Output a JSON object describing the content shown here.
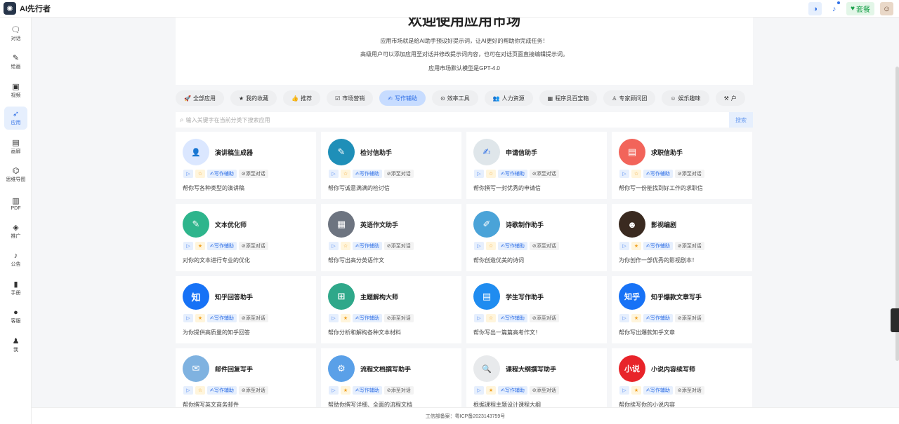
{
  "app": {
    "title": "AI先行者"
  },
  "topbar": {
    "plan_label": "套餐"
  },
  "sidebar": {
    "items": [
      {
        "label": "对话",
        "icon": "chat-icon",
        "glyph": "🗨"
      },
      {
        "label": "绘画",
        "icon": "brush-icon",
        "glyph": "✎"
      },
      {
        "label": "视频",
        "icon": "video-icon",
        "glyph": "▣"
      },
      {
        "label": "应用",
        "icon": "rocket-icon",
        "glyph": "➶",
        "active": true
      },
      {
        "label": "画廊",
        "icon": "gallery-icon",
        "glyph": "▤"
      },
      {
        "label": "思维导图",
        "icon": "mindmap-icon",
        "glyph": "⌬"
      },
      {
        "label": "PDF",
        "icon": "pdf-icon",
        "glyph": "▥"
      },
      {
        "label": "推广",
        "icon": "gem-icon",
        "glyph": "◈"
      },
      {
        "label": "公告",
        "icon": "bell-icon",
        "glyph": "♪"
      },
      {
        "label": "手册",
        "icon": "book-icon",
        "glyph": "▮"
      },
      {
        "label": "客服",
        "icon": "support-icon",
        "glyph": "●"
      },
      {
        "label": "我",
        "icon": "user-icon",
        "glyph": "♟"
      }
    ]
  },
  "hero": {
    "title": "欢迎使用应用市场",
    "line1": "应用市场就是给AI助手预设好提示词，让AI更好的帮助你完成任务！",
    "line2": "高级用户可以添加应用至对话并修改提示词内容，也可在对话页面直接编辑提示词。",
    "line3": "应用市场默认模型是GPT-4.0"
  },
  "tabs": [
    {
      "label": "全部应用",
      "glyph": "🚀"
    },
    {
      "label": "我的收藏",
      "glyph": "★"
    },
    {
      "label": "推荐",
      "glyph": "👍"
    },
    {
      "label": "市场营销",
      "glyph": "☑"
    },
    {
      "label": "写作辅助",
      "glyph": "✍",
      "active": true
    },
    {
      "label": "效率工具",
      "glyph": "⊙"
    },
    {
      "label": "人力资源",
      "glyph": "👥"
    },
    {
      "label": "程序员百宝箱",
      "glyph": "▦"
    },
    {
      "label": "专家顾问团",
      "glyph": "♙"
    },
    {
      "label": "娱乐趣味",
      "glyph": "☺"
    },
    {
      "label": "户",
      "glyph": "⚒"
    }
  ],
  "search": {
    "placeholder": "输入关键字在当前分类下搜索应用",
    "button": "搜索"
  },
  "card_labels": {
    "category": "写作辅助",
    "add": "添至对话"
  },
  "cards": [
    {
      "title": "演讲稿生成器",
      "desc": "帮你写各种类型的演讲稿",
      "fav": false,
      "avatar_color": "#dbe7ff",
      "avatar_text": "👤"
    },
    {
      "title": "检讨信助手",
      "desc": "帮你写诚意满满的检讨信",
      "fav": false,
      "avatar_color": "#1f8fb8",
      "avatar_text": "✎"
    },
    {
      "title": "申请信助手",
      "desc": "帮你撰写一封优秀的申请信",
      "fav": false,
      "avatar_color": "#dfe6ea",
      "avatar_text": "✍"
    },
    {
      "title": "求职信助手",
      "desc": "帮你写一份能找到好工作的求职信",
      "fav": false,
      "avatar_color": "#f2645a",
      "avatar_text": "▤"
    },
    {
      "title": "文本优化师",
      "desc": "对你的文本进行专业的优化",
      "fav": true,
      "avatar_color": "#2eb58c",
      "avatar_text": "✎"
    },
    {
      "title": "英语作文助手",
      "desc": "帮你写出高分英语作文",
      "fav": false,
      "avatar_color": "#6d7480",
      "avatar_text": "▦"
    },
    {
      "title": "诗歌制作助手",
      "desc": "帮你创造优美的诗词",
      "fav": false,
      "avatar_color": "#4aa3d8",
      "avatar_text": "✐"
    },
    {
      "title": "影视编剧",
      "desc": "为你创作一部优秀的影视剧本！",
      "fav": true,
      "avatar_color": "#3a2a20",
      "avatar_text": "☻"
    },
    {
      "title": "知乎回答助手",
      "desc": "为你提供高质量的知乎回答",
      "fav": true,
      "avatar_color": "#1772f6",
      "avatar_text": "知"
    },
    {
      "title": "主题解构大师",
      "desc": "帮你分析和解构各种文本材料",
      "fav": true,
      "avatar_color": "#2fa88a",
      "avatar_text": "⊞"
    },
    {
      "title": "学生写作助手",
      "desc": "帮你写出一篇篇高考作文！",
      "fav": false,
      "avatar_color": "#1f8cf0",
      "avatar_text": "▤"
    },
    {
      "title": "知乎爆款文章写手",
      "desc": "帮你写出爆款知乎文章",
      "fav": true,
      "avatar_color": "#1772f6",
      "avatar_text": "知乎"
    },
    {
      "title": "邮件回复写手",
      "desc": "帮你撰写英文商务邮件",
      "fav": false,
      "avatar_color": "#7fb2e0",
      "avatar_text": "✉"
    },
    {
      "title": "流程文档撰写助手",
      "desc": "帮助你撰写详细、全面的流程文档",
      "fav": true,
      "avatar_color": "#5aa0e8",
      "avatar_text": "⚙"
    },
    {
      "title": "课程大纲撰写助手",
      "desc": "根据课程主题设计课程大纲",
      "fav": true,
      "avatar_color": "#e8eaec",
      "avatar_text": "🔍"
    },
    {
      "title": "小说内容续写师",
      "desc": "帮你续写你的小说内容",
      "fav": true,
      "avatar_color": "#e8242a",
      "avatar_text": "小说"
    }
  ],
  "footer": {
    "text": "工信部备案：粤ICP备2023143759号"
  }
}
